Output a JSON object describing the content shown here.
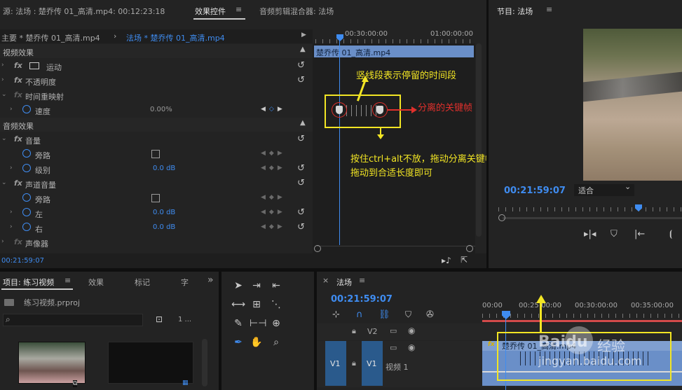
{
  "source_panel": {
    "source_tab": "源: 法场 : 楚乔传 01_高清.mp4: 00:12:23:18",
    "effect_controls_tab": "效果控件",
    "audio_mixer_tab": "音频剪辑混合器: 法场",
    "menu_glyph": "≡",
    "clip_master": "主要 * 楚乔传 01_高清.mp4",
    "clip_sequence": "法场 * 楚乔传 01_高清.mp4",
    "ruler_labels": [
      "00:30:00:00",
      "01:00:00:00"
    ],
    "clip_bar_label": "楚乔传 01_高清.mp4",
    "video_effects_header": "视频效果",
    "audio_effects_header": "音频效果",
    "rows": {
      "motion": "运动",
      "opacity": "不透明度",
      "time_remap": "时间重映射",
      "speed": "速度",
      "speed_value": "0.00%",
      "volume": "音量",
      "bypass": "旁路",
      "level": "级别",
      "level_value": "0.0 dB",
      "channel_volume": "声道音量",
      "bypass2": "旁路",
      "left": "左",
      "left_value": "0.0 dB",
      "right": "右",
      "right_value": "0.0 dB",
      "panner": "声像器"
    },
    "timecode": "00:21:59:07"
  },
  "annotations": {
    "vertical_segment": "竖线段表示停留的时间段",
    "separated_keyframe": "分离的关键帧",
    "instruction_line1": "按住ctrl+alt不放，拖动分离关键帧，",
    "instruction_line2": "拖动到合适长度即可"
  },
  "program_monitor": {
    "title": "节目: 法场",
    "menu_glyph": "≡",
    "timecode": "00:21:59:07",
    "fit_option": "适合",
    "fit_arrow": "⌄"
  },
  "project_panel": {
    "tabs": [
      "项目: 练习视频",
      "效果",
      "标记",
      "字"
    ],
    "menu_glyph": "≡",
    "more_glyph": "»",
    "project_file": "练习视频.prproj",
    "item_count": "1 ..."
  },
  "timeline": {
    "close_glyph": "×",
    "title": "法场",
    "menu_glyph": "≡",
    "timecode": "00:21:59:07",
    "ruler_labels": [
      "00:00",
      "00:25:00:00",
      "00:30:00:00",
      "00:35:00:00"
    ],
    "tracks": {
      "v2": "V2",
      "v1_source": "V1",
      "v1": "V1",
      "v1_name": "视频 1"
    },
    "clip_label": "楚乔传 01_高清.mp4"
  },
  "watermark": {
    "brand": "Baidu",
    "brand_cn": "经验",
    "url": "jingyan.baidu.com"
  },
  "colors": {
    "accent_blue": "#3f8cf0",
    "annotation_yellow": "#f2e524",
    "annotation_red": "#e0302c",
    "clip_blue": "#6a8fc8"
  }
}
